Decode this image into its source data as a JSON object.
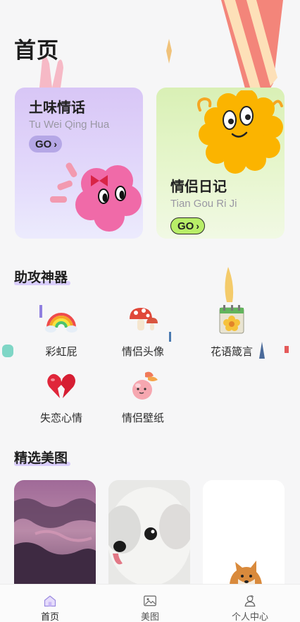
{
  "header": {
    "title": "首页"
  },
  "cards": [
    {
      "title": "土味情话",
      "subtitle": "Tu Wei Qing Hua",
      "cta": "GO",
      "color": "#d8c6f6"
    },
    {
      "title": "情侣日记",
      "subtitle": "Tian Gou Ri Ji",
      "cta": "GO",
      "color": "#d9f0b5"
    }
  ],
  "tools_section": {
    "title": "助攻神器",
    "items": [
      {
        "label": "彩虹屁",
        "icon": "rainbow-icon"
      },
      {
        "label": "情侣头像",
        "icon": "mushroom-icon"
      },
      {
        "label": "花语箴言",
        "icon": "flower-calendar-icon"
      },
      {
        "label": "失恋心情",
        "icon": "broken-heart-icon"
      },
      {
        "label": "情侣壁纸",
        "icon": "peach-bird-icon"
      }
    ]
  },
  "gallery_section": {
    "title": "精选美图"
  },
  "tabbar": {
    "items": [
      {
        "label": "首页",
        "icon": "home-icon",
        "active": true
      },
      {
        "label": "美图",
        "icon": "picture-icon",
        "active": false
      },
      {
        "label": "个人中心",
        "icon": "user-icon",
        "active": false
      }
    ]
  },
  "colors": {
    "accent_purple": "#d8c6f6",
    "accent_green": "#b8ee68",
    "background": "#f6f6f7"
  }
}
